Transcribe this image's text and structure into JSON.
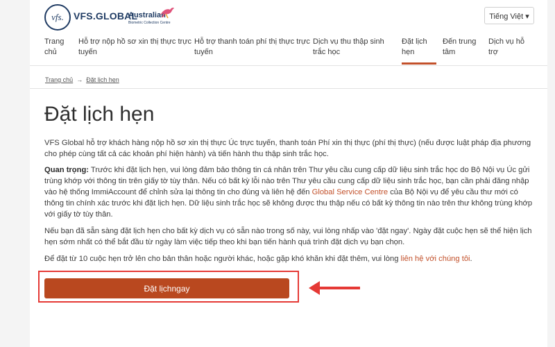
{
  "header": {
    "logo_mark": "vfs.",
    "brand": "VFS.GLOBAL",
    "partner_name": "Australian",
    "partner_sub": "Biometric Collection Centre",
    "language": "Tiếng Việt ▾"
  },
  "nav": [
    {
      "line1": "Trang",
      "line2": "chủ"
    },
    {
      "line1": "Hỗ trợ nộp hồ sơ xin thị thực trực",
      "line2": "tuyến"
    },
    {
      "line1": "Hỗ trợ thanh toán phí thị thực trực",
      "line2": "tuyến"
    },
    {
      "line1": "Dịch vụ thu thập sinh",
      "line2": "trắc học"
    },
    {
      "line1": "Đặt lịch",
      "line2": "hẹn"
    },
    {
      "line1": "Đến trung",
      "line2": "tâm"
    },
    {
      "line1": "Dịch vụ hỗ",
      "line2": "trợ"
    }
  ],
  "breadcrumb": {
    "home": "Trang chủ",
    "separator": "→",
    "current": "Đặt lịch hẹn"
  },
  "page": {
    "title": "Đặt lịch hẹn",
    "p1": "VFS Global hỗ trợ khách hàng nộp hồ sơ xin thị thực Úc trực tuyến, thanh toán Phí xin thị thực (phí thị thực) (nếu được luật pháp địa phương cho phép cùng tất cả các khoản phí hiện hành) và tiến hành thu thập sinh trắc học.",
    "p2_bold": "Quan trọng:",
    "p2_a": " Trước khi đặt lịch hẹn, vui lòng đảm bảo thông tin cá nhân trên Thư yêu cầu cung cấp dữ liệu sinh trắc học do Bộ Nội vụ Úc gửi trùng khớp với thông tin trên giấy tờ tùy thân. Nếu có bất kỳ lỗi nào trên Thư yêu cầu cung cấp dữ liệu sinh trắc học, bạn cần phải đăng nhập vào hệ thống ImmiAccount để chỉnh sửa lại thông tin cho đúng và liên hệ đến ",
    "p2_link": "Global Service Centre",
    "p2_b": " của Bộ Nội vụ để yêu cầu thư mới có thông tin chính xác trước khi đặt lịch hẹn. Dữ liệu sinh trắc học sẽ không được thu thập nếu có bất kỳ thông tin nào trên thư không trùng khớp với giấy tờ tùy thân.",
    "p3": "Nếu bạn đã sẵn sàng đặt lịch hẹn cho bất kỳ dịch vụ có sẵn nào trong số này, vui lòng nhấp vào 'đặt ngay'. Ngày đặt cuộc hẹn sẽ thể hiện lịch hẹn sớm nhất có thể bắt đầu từ ngày làm việc tiếp theo khi bạn tiến hành quá trình đặt dịch vụ bạn chọn.",
    "p4_a": "Để đặt từ 10 cuộc hẹn trở lên cho bản thân hoặc người khác, hoặc gặp khó khăn khi đặt thêm, vui lòng ",
    "p4_link": "liên hệ với chúng tôi",
    "p4_b": ".",
    "book_button": "Đặt lịchngay"
  },
  "colors": {
    "accent": "#b9481f",
    "brand": "#1f3b63",
    "annotation": "#e53935"
  },
  "icons": {
    "arrow": "red-left-arrow-icon",
    "kangaroo": "kangaroo-logo-icon"
  }
}
